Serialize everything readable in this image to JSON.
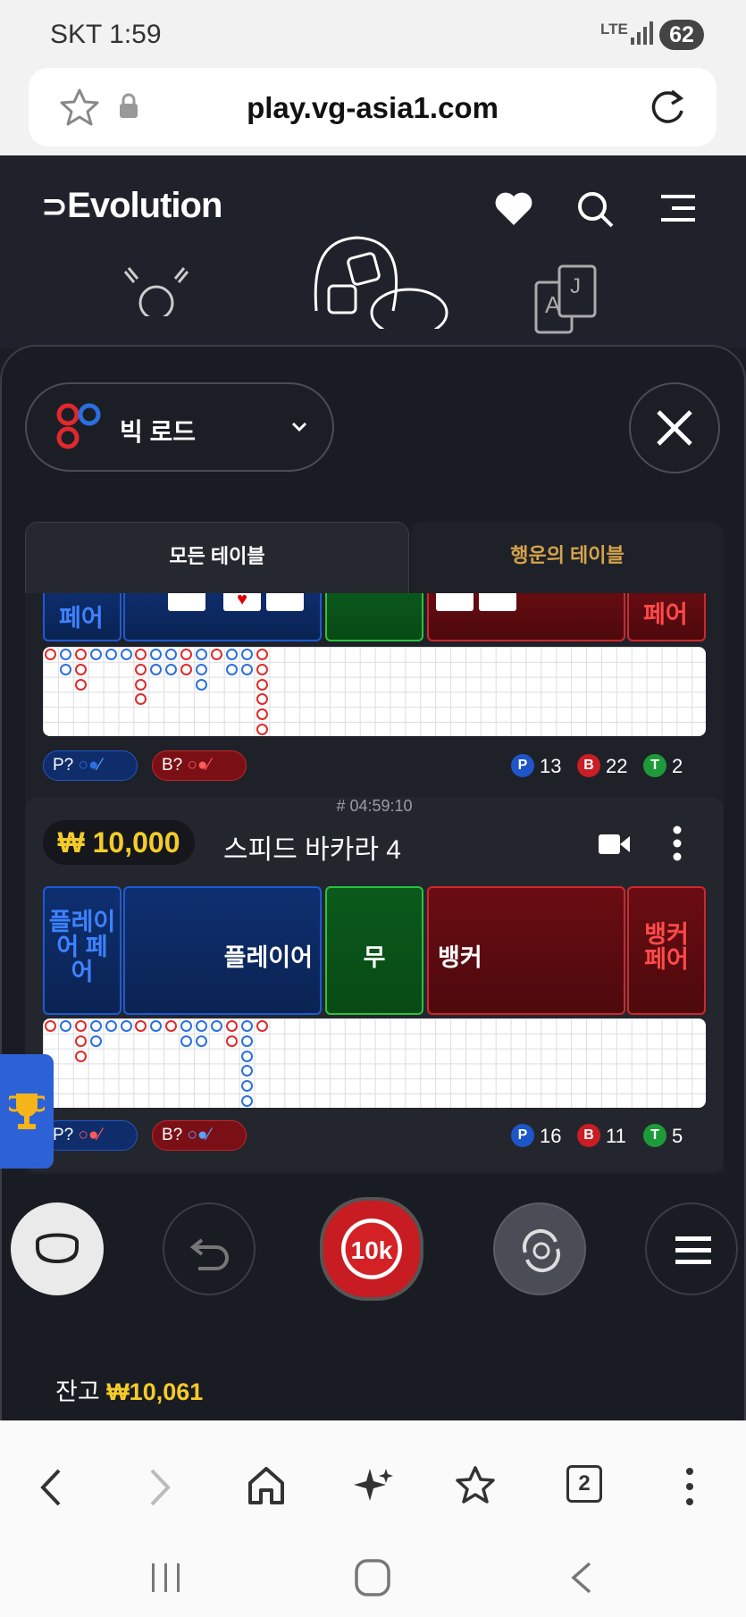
{
  "status_bar": {
    "time": "SKT 1:59",
    "network": "LTE",
    "battery": "62"
  },
  "browser": {
    "url": "play.vg-asia1.com"
  },
  "site": {
    "brand": "Evolution"
  },
  "selector": {
    "label": "빅 로드"
  },
  "tabs": [
    {
      "label": "모든 테이블"
    },
    {
      "label": "행운의 테이블"
    }
  ],
  "tables": [
    {
      "bets": {
        "player_pair": "페어",
        "banker_pair": "페어"
      },
      "predict": {
        "player": "P?",
        "banker": "B?"
      },
      "counts": {
        "p_letter": "P",
        "p": "13",
        "b_letter": "B",
        "b": "22",
        "t_letter": "T",
        "t": "2"
      }
    },
    {
      "id": "# 04:59:10",
      "min_bet": "₩ 10,000",
      "name": "스피드 바카라 4",
      "bets": {
        "player_pair": "플레이어 페어",
        "player": "플레이어",
        "tie": "무",
        "banker": "뱅커",
        "banker_pair": "뱅커 페어"
      },
      "predict": {
        "player": "P?",
        "banker": "B?"
      },
      "counts": {
        "p_letter": "P",
        "p": "16",
        "b_letter": "B",
        "b": "11",
        "t_letter": "T",
        "t": "5"
      }
    }
  ],
  "chip": {
    "label": "10k"
  },
  "balance": {
    "label": "잔고",
    "amount": "₩10,061"
  },
  "browser_toolbar": {
    "tabs_count": "2"
  },
  "colors": {
    "accent_gold": "#f4cc2a",
    "player_blue": "#1d5ad6",
    "banker_red": "#d0262c",
    "tie_green": "#27c43e",
    "lucky_tab": "#d4a34a"
  }
}
